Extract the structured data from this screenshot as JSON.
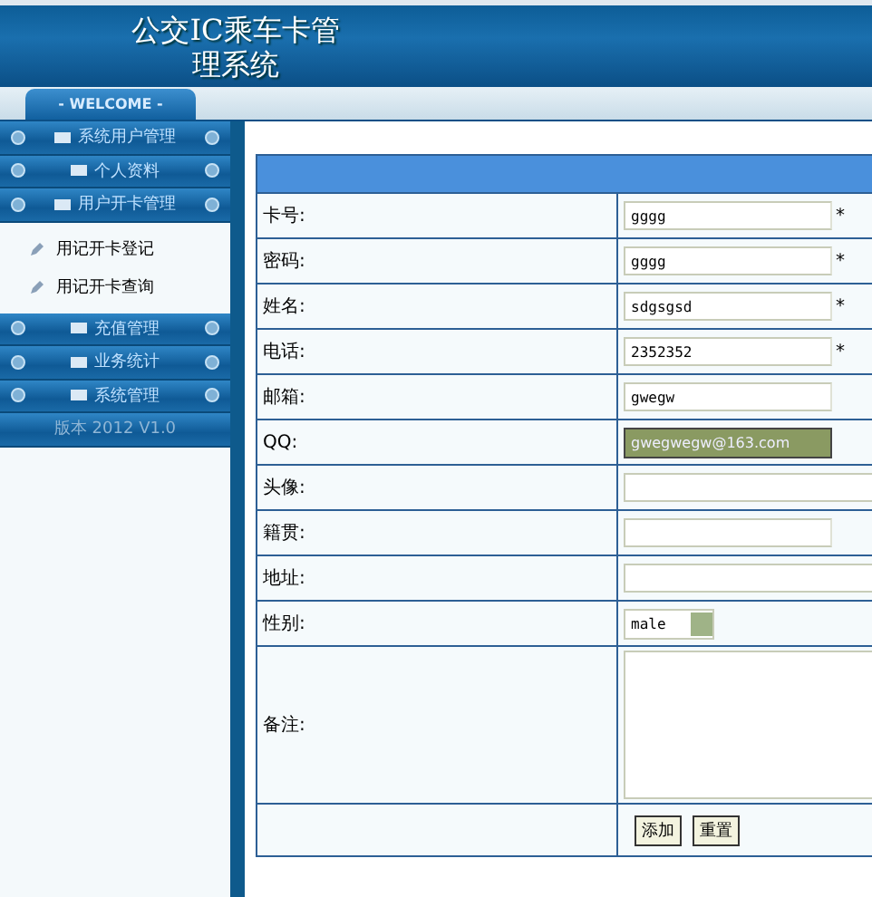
{
  "header": {
    "title": "公交IC乘车卡管理系统"
  },
  "welcome_tab": {
    "label": "- WELCOME -"
  },
  "sidebar": {
    "items": [
      {
        "label": "系统用户管理"
      },
      {
        "label": "个人资料"
      },
      {
        "label": "用户开卡管理",
        "children": [
          {
            "label": "用记开卡登记"
          },
          {
            "label": "用记开卡查询"
          }
        ]
      },
      {
        "label": "充值管理"
      },
      {
        "label": "业务统计"
      },
      {
        "label": "系统管理"
      }
    ],
    "version": "版本 2012 V1.0"
  },
  "form": {
    "rows": [
      {
        "label": "卡号:",
        "kind": "input",
        "value": "gggg",
        "required_mark": "*"
      },
      {
        "label": "密码:",
        "kind": "input",
        "value": "gggg",
        "required_mark": "*"
      },
      {
        "label": "姓名:",
        "kind": "input",
        "value": "sdgsgsd",
        "required_mark": "*"
      },
      {
        "label": "电话:",
        "kind": "input",
        "value": "2352352",
        "required_mark": "*"
      },
      {
        "label": "邮箱:",
        "kind": "input",
        "value": "gwegw"
      },
      {
        "label": "QQ:",
        "kind": "autocomplete",
        "suggestion": "gwegwegw@163.com"
      },
      {
        "label": "头像:",
        "kind": "wide-input"
      },
      {
        "label": "籍贯:",
        "kind": "input"
      },
      {
        "label": "地址:",
        "kind": "wide-input"
      },
      {
        "label": "性别:",
        "kind": "select",
        "value": "male"
      },
      {
        "label": "备注:",
        "kind": "textarea"
      }
    ],
    "buttons": [
      "添加",
      "重置"
    ]
  }
}
